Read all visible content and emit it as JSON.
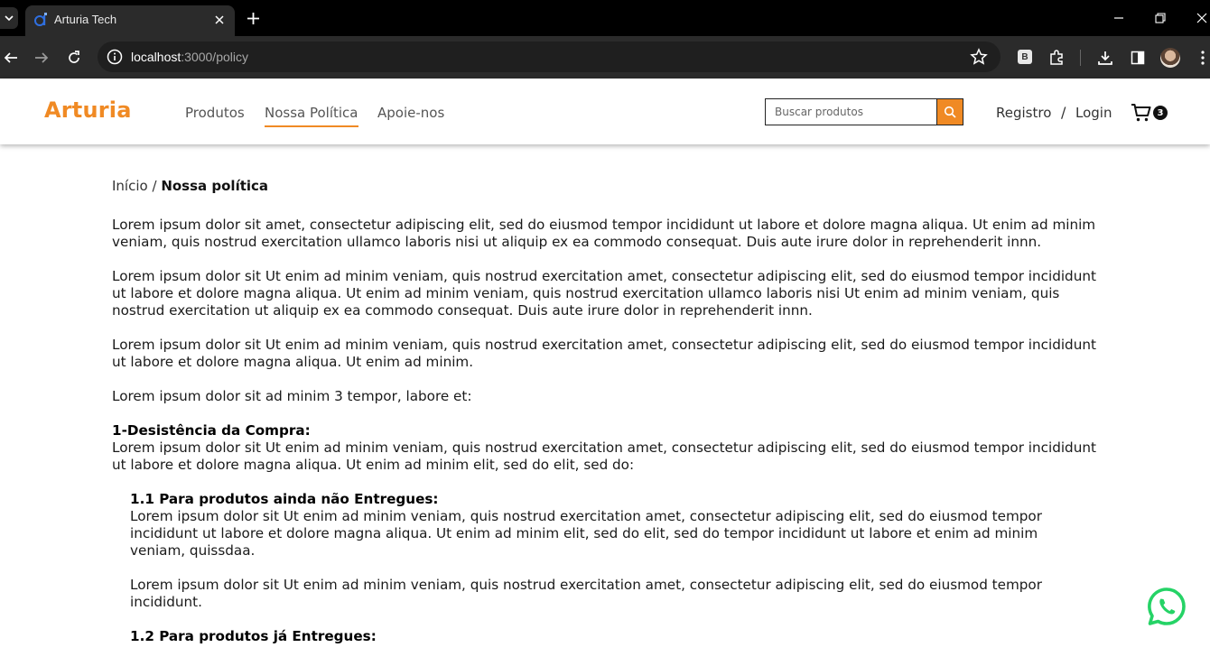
{
  "browser": {
    "tab_title": "Arturia Tech",
    "url_host": "localhost",
    "url_path": ":3000/policy",
    "extension_label": "B"
  },
  "header": {
    "logo": "Arturia",
    "nav": [
      {
        "label": "Produtos"
      },
      {
        "label": "Nossa Política",
        "active": true
      },
      {
        "label": "Apoie-nos"
      }
    ],
    "search": {
      "placeholder": "Buscar produtos",
      "value": ""
    },
    "register_label": "Registro",
    "auth_separator": "/",
    "login_label": "Login",
    "cart_count": "3",
    "accent_color": "#f08a24"
  },
  "breadcrumb": {
    "home": "Início",
    "separator": "/",
    "current": "Nossa política"
  },
  "content": {
    "paragraphs": [
      "Lorem ipsum dolor sit amet, consectetur adipiscing elit, sed do eiusmod tempor incididunt ut labore et dolore magna aliqua. Ut enim ad minim veniam, quis nostrud exercitation ullamco laboris nisi ut aliquip ex ea commodo consequat. Duis aute irure dolor in reprehenderit innn.",
      "Lorem ipsum dolor sit Ut enim ad minim veniam, quis nostrud exercitation amet, consectetur adipiscing elit, sed do eiusmod tempor incididunt ut labore et dolore magna aliqua. Ut enim ad minim veniam, quis nostrud exercitation ullamco laboris nisi Ut enim ad minim veniam, quis nostrud exercitation ut aliquip ex ea commodo consequat. Duis aute irure dolor in reprehenderit innn.",
      "Lorem ipsum dolor sit Ut enim ad minim veniam, quis nostrud exercitation amet, consectetur adipiscing elit, sed do eiusmod tempor incididunt ut labore et dolore magna aliqua. Ut enim ad minim.",
      "Lorem ipsum dolor sit ad minim 3 tempor, labore et:"
    ],
    "section1": {
      "title": "1-Desistência da Compra:",
      "text": "Lorem ipsum dolor sit Ut enim ad minim veniam, quis nostrud exercitation amet, consectetur adipiscing elit, sed do eiusmod tempor incididunt ut labore et dolore magna aliqua. Ut enim ad minim elit, sed do elit, sed do:"
    },
    "section1_1": {
      "title": "1.1 Para produtos ainda não Entregues:",
      "text": "Lorem ipsum dolor sit Ut enim ad minim veniam, quis nostrud exercitation amet, consectetur adipiscing elit, sed do eiusmod tempor incididunt ut labore et dolore magna aliqua. Ut enim ad minim elit, sed do elit, sed do tempor incididunt ut labore et enim ad minim veniam, quissdaa.",
      "text2": "Lorem ipsum dolor sit Ut enim ad minim veniam, quis nostrud exercitation amet, consectetur adipiscing elit, sed do eiusmod tempor incididunt."
    },
    "section1_2": {
      "title": "1.2 Para produtos já Entregues:"
    }
  }
}
